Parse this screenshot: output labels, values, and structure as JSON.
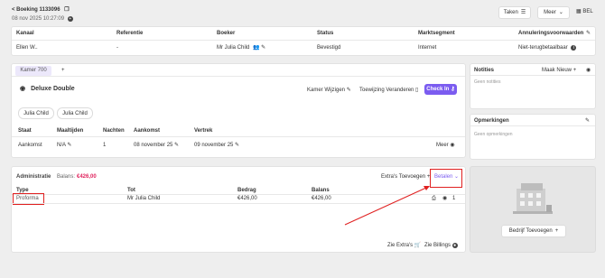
{
  "header": {
    "back_label": "< Boeking 1133096",
    "datetime": "08 nov 2025 10:27:09",
    "tasks_label": "Taken",
    "more_label": "Meer",
    "lang": "BEL"
  },
  "booking_table": {
    "columns": [
      "Kanaal",
      "Referentie",
      "Boeker",
      "Status",
      "Marktsegment",
      "Annuleringsvoorwaarden"
    ],
    "row": [
      "Ellen W..",
      "-",
      "Mr Julia Child",
      "Bevestigd",
      "Internet",
      "Niet-terugbetaalbaar"
    ]
  },
  "room": {
    "tab_label": "Kamer 700",
    "add_tab": "+",
    "type": "Deluxe Double",
    "change_room_label": "Kamer Wijzigen",
    "change_assign_label": "Toewijzing Veranderen",
    "checkin_label": "Check In",
    "guests": [
      "Julia Child",
      "Julia Child"
    ],
    "stay_columns": [
      "Staat",
      "Maaltijden",
      "Nachten",
      "Aankomst",
      "Vertrek"
    ],
    "stay_row": {
      "state": "Aankomst",
      "meals": "N/A",
      "nights": "1",
      "arrival": "08 november 25",
      "departure": "09 november 25",
      "more_label": "Meer"
    }
  },
  "admin": {
    "title": "Administratie",
    "balance_label": "Balans:",
    "balance_value": "€426,00",
    "extra_label": "Extra's Toevoegen",
    "pay_label": "Betalen",
    "columns": [
      "Type",
      "Tot",
      "Bedrag",
      "Balans"
    ],
    "row": {
      "type": "Proforma",
      "to": "Mr Julia Child",
      "amount": "€426,00",
      "balance": "€426,00",
      "count": "1"
    },
    "see_extras": "Zie Extra's",
    "see_billings": "Zie Billings"
  },
  "notes": {
    "title": "Notities",
    "add_label": "Maak Nieuw",
    "empty": "Geen notities"
  },
  "remarks": {
    "title": "Opmerkingen",
    "empty": "Geen opmerkingen"
  },
  "company": {
    "add_label": "Bedrijf Toevoegen"
  },
  "colors": {
    "accent": "#7b5cf0",
    "balance": "#e0245e",
    "highlight": "#e02020"
  }
}
